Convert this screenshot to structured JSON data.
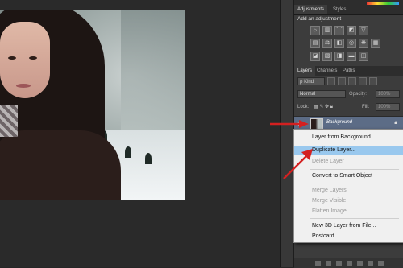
{
  "panel": {
    "top_tabs": [
      "Adjustments",
      "Styles"
    ],
    "adjustments_title": "Add an adjustment",
    "layer_tabs": [
      "Layers",
      "Channels",
      "Paths"
    ],
    "kind_label": "ρ Kind",
    "blend_mode": "Normal",
    "opacity_label": "Opacity:",
    "opacity_value": "100%",
    "lock_label": "Lock:",
    "fill_label": "Fill:",
    "fill_value": "100%",
    "layer_name": "Background"
  },
  "context_menu": {
    "items": [
      {
        "label": "Layer from Background...",
        "enabled": true
      },
      {
        "label": "Duplicate Layer...",
        "enabled": true,
        "highlighted": true
      },
      {
        "label": "Delete Layer",
        "enabled": false
      },
      {
        "label": "Convert to Smart Object",
        "enabled": true
      },
      {
        "label": "Merge Layers",
        "enabled": false
      },
      {
        "label": "Merge Visible",
        "enabled": false
      },
      {
        "label": "Flatten Image",
        "enabled": false
      },
      {
        "label": "New 3D Layer from File...",
        "enabled": true
      },
      {
        "label": "Postcard",
        "enabled": true
      }
    ]
  },
  "colors": {
    "highlight": "#99c8ee",
    "selected_layer": "#5c6c86",
    "arrow": "#d42020"
  }
}
